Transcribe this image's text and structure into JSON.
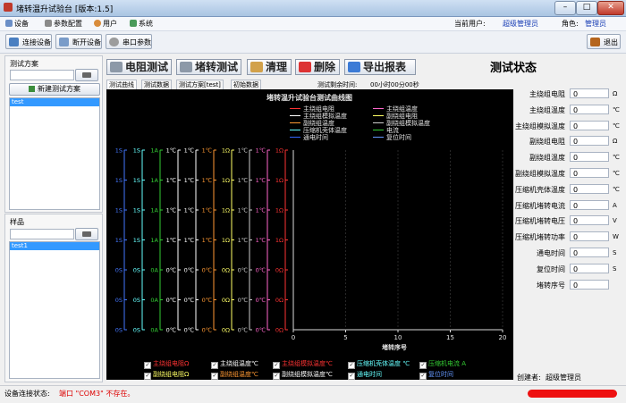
{
  "window": {
    "title": "堵转温升试验台 [版本:1.5]",
    "min": "–",
    "max": "□",
    "close": "✕"
  },
  "menu": {
    "items": [
      "设备",
      "参数配置",
      "用户",
      "系统"
    ],
    "current_user_label": "当前用户:",
    "current_user": "超级管理员",
    "role_label": "角色:",
    "role": "管理员"
  },
  "toolbar": {
    "connect": "连接设备",
    "disconnect": "断开设备",
    "serial": "串口参数",
    "exit": "退出"
  },
  "left": {
    "scheme_title": "测试方案",
    "new_scheme": "新建测试方案",
    "schemes": [
      "test"
    ],
    "sample_title": "样品",
    "samples": [
      "test1"
    ]
  },
  "actions": {
    "resistance": "电阻测试",
    "locked": "堵转测试",
    "clear": "清理",
    "delete": "删除",
    "export": "导出报表"
  },
  "tabs": [
    "测试曲线",
    "测试数据",
    "测试方案[test]",
    "初始数据"
  ],
  "remaining_label": "测试剩余时间:",
  "remaining": "00小时00分00秒",
  "status_title": "测试状态",
  "chart_data": {
    "type": "line",
    "title": "堵转温升试验台测试曲线图",
    "xlabel": "堵转序号",
    "xlim": [
      0,
      20
    ],
    "xticks": [
      0,
      5,
      10,
      15,
      20
    ],
    "legend": [
      {
        "name": "主绕组电阻",
        "color": "#ff3333"
      },
      {
        "name": "主绕组温度",
        "color": "#ff66cc"
      },
      {
        "name": "主绕组模拟温度",
        "color": "#ffffff"
      },
      {
        "name": "副绕组电阻",
        "color": "#ffff66"
      },
      {
        "name": "副绕组温度",
        "color": "#ff9933"
      },
      {
        "name": "副绕组模拟温度",
        "color": "#cccccc"
      },
      {
        "name": "压缩机壳体温度",
        "color": "#66ffff"
      },
      {
        "name": "电流",
        "color": "#33cc33"
      },
      {
        "name": "通电时间",
        "color": "#3366ff"
      },
      {
        "name": "复位时间",
        "color": "#6699ff"
      }
    ],
    "axes": [
      {
        "color": "#4477ff",
        "ticks": [
          "1S",
          "1S",
          "1S",
          "1S",
          "0S",
          "0S",
          "0S"
        ]
      },
      {
        "color": "#66ffff",
        "ticks": [
          "1S",
          "1S",
          "1S",
          "1S",
          "0S",
          "0S",
          "0S"
        ]
      },
      {
        "color": "#33cc33",
        "ticks": [
          "1A",
          "1A",
          "1A",
          "1A",
          "0A",
          "0A",
          "0A"
        ]
      },
      {
        "color": "#ffffff",
        "ticks": [
          "1℃",
          "1℃",
          "1℃",
          "1℃",
          "0℃",
          "0℃",
          "0℃"
        ]
      },
      {
        "color": "#ffffff",
        "ticks": [
          "1℃",
          "1℃",
          "1℃",
          "1℃",
          "0℃",
          "0℃",
          "0℃"
        ]
      },
      {
        "color": "#ff9933",
        "ticks": [
          "1℃",
          "1℃",
          "1℃",
          "1℃",
          "0℃",
          "0℃",
          "0℃"
        ]
      },
      {
        "color": "#ffff66",
        "ticks": [
          "1Ω",
          "1Ω",
          "1Ω",
          "1Ω",
          "0Ω",
          "0Ω",
          "0Ω"
        ]
      },
      {
        "color": "#cccccc",
        "ticks": [
          "1℃",
          "1℃",
          "1℃",
          "1℃",
          "0℃",
          "0℃",
          "0℃"
        ]
      },
      {
        "color": "#ff66cc",
        "ticks": [
          "1℃",
          "1℃",
          "1℃",
          "1℃",
          "0℃",
          "0℃",
          "0℃"
        ]
      },
      {
        "color": "#ff3333",
        "ticks": [
          "1Ω",
          "1Ω",
          "1Ω",
          "1Ω",
          "0Ω",
          "0Ω",
          "0Ω"
        ]
      }
    ],
    "series": []
  },
  "checkboxes": [
    {
      "label": "主绕组电阻Ω",
      "color": "#ff3333"
    },
    {
      "label": "主绕组温度℃",
      "color": "#ffffff"
    },
    {
      "label": "主绕组模拟温度℃",
      "color": "#ff3333"
    },
    {
      "label": "压缩机壳体温度 ℃",
      "color": "#66ffff"
    },
    {
      "label": "压缩机电流 A",
      "color": "#33cc33"
    },
    {
      "label": "副绕组电阻Ω",
      "color": "#ffff66"
    },
    {
      "label": "副绕组温度℃",
      "color": "#ff9933"
    },
    {
      "label": "副绕组模拟温度℃",
      "color": "#ffffff"
    },
    {
      "label": "通电时间",
      "color": "#66ffff"
    },
    {
      "label": "复位时间",
      "color": "#6699ff"
    }
  ],
  "status_fields": [
    {
      "label": "主绕组电阻",
      "value": "0",
      "unit": "Ω"
    },
    {
      "label": "主绕组温度",
      "value": "0",
      "unit": "℃"
    },
    {
      "label": "主绕组模拟温度",
      "value": "0",
      "unit": "℃"
    },
    {
      "label": "副绕组电阻",
      "value": "0",
      "unit": "Ω"
    },
    {
      "label": "副绕组温度",
      "value": "0",
      "unit": "℃"
    },
    {
      "label": "副绕组模拟温度",
      "value": "0",
      "unit": "℃"
    },
    {
      "label": "压缩机壳体温度",
      "value": "0",
      "unit": "℃"
    },
    {
      "label": "压缩机堵转电流",
      "value": "0",
      "unit": "A"
    },
    {
      "label": "压缩机堵转电压",
      "value": "0",
      "unit": "V"
    },
    {
      "label": "压缩机堵转功率",
      "value": "0",
      "unit": "W"
    },
    {
      "label": "通电时间",
      "value": "0",
      "unit": "S"
    },
    {
      "label": "复位时间",
      "value": "0",
      "unit": "S"
    },
    {
      "label": "堵转序号",
      "value": "0",
      "unit": ""
    }
  ],
  "creator_label": "创建者:",
  "creator": "超级管理员",
  "status": {
    "label": "设备连接状态:",
    "message": "端口 \"COM3\" 不存在。"
  }
}
